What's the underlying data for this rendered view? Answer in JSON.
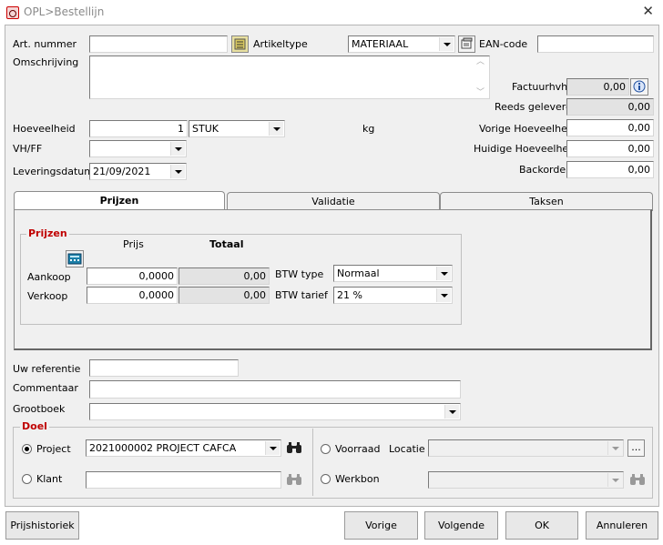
{
  "window": {
    "title": "OPL>Bestellijn",
    "close": "✕"
  },
  "article": {
    "art_nummer_label": "Art. nummer",
    "art_nummer_value": "",
    "artikeltype_label": "Artikeltype",
    "artikeltype_value": "MATERIAAL",
    "ean_label": "EAN-code",
    "ean_value": "",
    "omschrijving_label": "Omschrijving",
    "omschrijving_value": ""
  },
  "right_fields": {
    "factuurhvh_label": "Factuurhvh.",
    "factuurhvh_value": "0,00",
    "reeds_geleverd_label": "Reeds geleverd",
    "reeds_geleverd_value": "0,00",
    "vorige_label": "Vorige Hoeveelheid",
    "vorige_value": "0,00",
    "huidige_label": "Huidige Hoeveelheid",
    "huidige_value": "0,00",
    "backorder_label": "Backorder",
    "backorder_value": "0,00"
  },
  "quantity": {
    "hoeveelheid_label": "Hoeveelheid",
    "hoeveelheid_value": "1",
    "unit_value": "STUK",
    "kg_label": "kg",
    "vhff_label": "VH/FF",
    "vhff_value": "",
    "leveringsdatum_label": "Leveringsdatum",
    "leveringsdatum_value": "21/09/2021"
  },
  "tabs": [
    {
      "label": "Prijzen",
      "active": true
    },
    {
      "label": "Validatie",
      "active": false
    },
    {
      "label": "Taksen",
      "active": false
    }
  ],
  "prijzen": {
    "group_title": "Prijzen",
    "prijs_header": "Prijs",
    "totaal_header": "Totaal",
    "aankoop_label": "Aankoop",
    "aankoop_prijs": "0,0000",
    "aankoop_totaal": "0,00",
    "verkoop_label": "Verkoop",
    "verkoop_prijs": "0,0000",
    "verkoop_totaal": "0,00",
    "btw_type_label": "BTW type",
    "btw_type_value": "Normaal",
    "btw_tarief_label": "BTW tarief",
    "btw_tarief_value": "21 %"
  },
  "refs": {
    "uw_referentie_label": "Uw referentie",
    "uw_referentie_value": "",
    "commentaar_label": "Commentaar",
    "commentaar_value": "",
    "grootboek_label": "Grootboek",
    "grootboek_value": ""
  },
  "doel": {
    "title": "Doel",
    "project_label": "Project",
    "project_value": "2021000002 PROJECT CAFCA",
    "project_selected": true,
    "klant_label": "Klant",
    "klant_value": "",
    "voorraad_label": "Voorraad",
    "locatie_label": "Locatie",
    "locatie_value": "",
    "ellipsis": "...",
    "werkbon_label": "Werkbon",
    "werkbon_value": ""
  },
  "buttons": {
    "prijshistoriek": "Prijshistoriek",
    "vorige": "Vorige",
    "volgende": "Volgende",
    "ok": "OK",
    "annuleren": "Annuleren"
  },
  "icons": {
    "lookup": "lookup-icon",
    "info": "info-icon",
    "calculator": "calculator-icon",
    "binoculars": "binoculars-icon"
  }
}
